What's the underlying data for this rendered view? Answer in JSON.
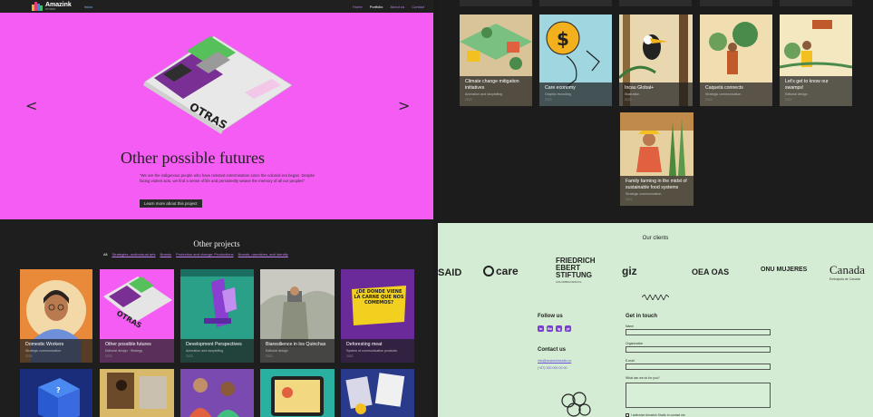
{
  "nav": {
    "logo_name": "Amazink",
    "logo_sub": "STUDIO",
    "lang": "Inicio",
    "links": [
      {
        "label": "Home",
        "active": false
      },
      {
        "label": "Portfolio",
        "active": true
      },
      {
        "label": "About us",
        "active": false
      },
      {
        "label": "Contact",
        "active": false
      }
    ]
  },
  "hero": {
    "prev": "<",
    "next": ">",
    "title": "Other possible futures",
    "quote": "\"We are the indigenous people who have resisted extermination since the colonial era began. Despite facing violent acts, we find a sense of life and persistently weave the memory of all our peoples\"",
    "button": "Learn more about this project"
  },
  "other": {
    "title": "Other projects",
    "filters": [
      "All",
      "Strategies, audiovisual arts",
      "Brands",
      "Protection and change: Productions",
      "Brands, narratives, and identity"
    ]
  },
  "left_cards": [
    {
      "title": "Domestic Workers",
      "cat": "Strategic communication",
      "year": "2023"
    },
    {
      "title": "Other possible futures",
      "cat": "Editorial design · Strategy",
      "year": "2023"
    },
    {
      "title": "Development Perspectives",
      "cat": "Animation and storytelling",
      "year": "2023"
    },
    {
      "title": "Biaresilience in los Quinchas",
      "cat": "Editorial design",
      "year": "2022"
    },
    {
      "title": "Deforesting meat",
      "cat": "System of communication products",
      "year": "2022"
    }
  ],
  "right_cards": [
    {
      "title": "Climate change mitigation initiatives",
      "cat": "Animation and storytelling",
      "year": "2023"
    },
    {
      "title": "Care economy",
      "cat": "Graphic recording",
      "year": "2023"
    },
    {
      "title": "Incau Global+",
      "cat": "Illustration",
      "year": "2023"
    },
    {
      "title": "Caquetá connects",
      "cat": "Strategic communication",
      "year": "2023"
    },
    {
      "title": "Let's get to know our swamps!",
      "cat": "Editorial design",
      "year": "2022"
    },
    {
      "title": "Family farming in the midst of sustainable food systems",
      "cat": "Strategic communication",
      "year": "2022"
    }
  ],
  "card_images": {
    "deforest_sign": "¿DE DÓNDE VIENE LA CARNE QUE NOS COMEMOS?",
    "book_title": "OTRAS"
  },
  "clients": {
    "title": "Our clients",
    "logos": [
      "SAID",
      "care",
      "FRIEDRICH EBERT STIFTUNG",
      "giz",
      "OEA OAS",
      "ONU MUJERES",
      "Canada"
    ],
    "logo_sub": [
      "COLOMBIA FESCOL",
      "Embajada de Canadá"
    ]
  },
  "footer": {
    "follow_title": "Follow us",
    "socials": [
      "in",
      "Be",
      "ig",
      "yt"
    ],
    "contact_title": "Contact us",
    "email": "info@amazinkstudio.co",
    "phone": "(+57) 300 000 00 00",
    "form_title": "Get in touch",
    "fields": [
      "Name",
      "Organization",
      "E-mail",
      "What can we do for you?"
    ],
    "consent": "I authorize Amazink Studio to contact me"
  },
  "colors": {
    "hero_bg": "#f45cf4",
    "footer_bg": "#d3ecd3",
    "accent": "#7a3fd0"
  }
}
